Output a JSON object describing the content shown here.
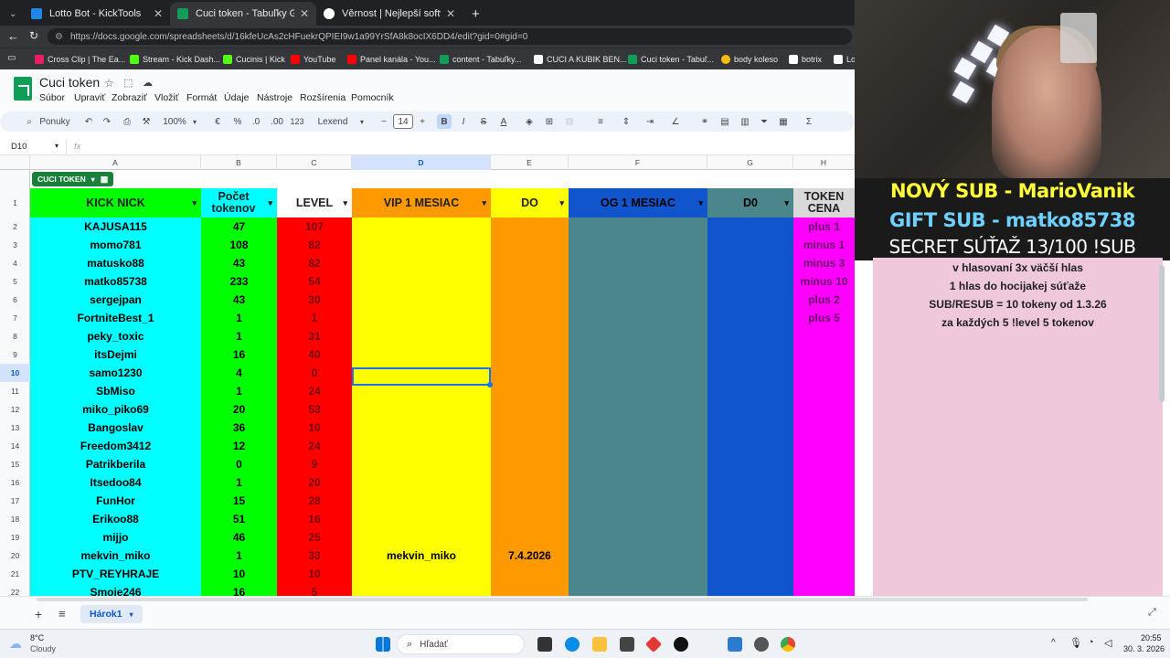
{
  "browser": {
    "tabs": [
      {
        "title": "Lotto Bot - KickTools",
        "icon_color": "#1e88e5"
      },
      {
        "title": "Cuci token - Tabuľky Google",
        "icon_color": "#0f9d58"
      },
      {
        "title": "Věrnost | Nejlepší software pro vyh",
        "icon_color": "#ffffff"
      }
    ],
    "url": "https://docs.google.com/spreadsheets/d/16kfeUcAs2cHFuekrQPIEI9w1a99YrSfA8k8ocIX6DD4/edit?gid=0#gid=0",
    "bookmarks": [
      {
        "label": "Cross Clip | The Ea...",
        "color": "#e91e63"
      },
      {
        "label": "Stream - Kick Dash...",
        "color": "#53fc18"
      },
      {
        "label": "Cucinis | Kick",
        "color": "#53fc18"
      },
      {
        "label": "YouTube",
        "color": "#ff0000"
      },
      {
        "label": "Panel kanála - You...",
        "color": "#ff0000"
      },
      {
        "label": "content - Tabuľky...",
        "color": "#0f9d58"
      },
      {
        "label": "CUCI A KUBIK BEN...",
        "color": "#ffffff"
      },
      {
        "label": "Cuci token - Tabuľ...",
        "color": "#0f9d58"
      },
      {
        "label": "body koleso",
        "color": "#fbbc04"
      },
      {
        "label": "botrix",
        "color": "#ffffff"
      },
      {
        "label": "Lo",
        "color": "#ffffff"
      }
    ]
  },
  "sheets": {
    "title": "Cuci token",
    "menu": [
      "Súbor",
      "Upraviť",
      "Zobraziť",
      "Vložiť",
      "Formát",
      "Údaje",
      "Nástroje",
      "Rozšírenia",
      "Pomocník"
    ],
    "toolbar": {
      "search": "Ponuky",
      "zoom": "100%",
      "currency": "€",
      "percent": "%",
      "dec_minus": ".0",
      "dec_plus": ".00",
      "format": "123",
      "font": "Lexend",
      "font_size": "14",
      "bold": "B",
      "italic": "I",
      "strike": "S",
      "text_color": "A"
    },
    "cell_ref": "D10",
    "fx": "fx",
    "columns": [
      "A",
      "B",
      "C",
      "D",
      "E",
      "F",
      "G",
      "H"
    ],
    "table_name": "CUCI TOKEN",
    "headers": [
      "KICK NICK",
      "Počet tokenov",
      "LEVEL",
      "VIP 1 MESIAC",
      "DO",
      "OG 1 MESIAC",
      "D0",
      "TOKEN CENA"
    ],
    "row_numbers": [
      "1",
      "2",
      "3",
      "4",
      "5",
      "6",
      "7",
      "8",
      "9",
      "10",
      "11",
      "12",
      "13",
      "14",
      "15",
      "16",
      "17",
      "18",
      "19",
      "20",
      "21",
      "22"
    ],
    "rows": [
      [
        "KAJUSA115",
        "47",
        "107",
        "",
        "",
        "plus 1"
      ],
      [
        "momo781",
        "108",
        "82",
        "",
        "",
        "minus 1"
      ],
      [
        "matusko88",
        "43",
        "82",
        "",
        "",
        "minus 3"
      ],
      [
        "matko85738",
        "233",
        "54",
        "",
        "",
        "minus 10"
      ],
      [
        "sergejpan",
        "43",
        "30",
        "",
        "",
        "plus 2"
      ],
      [
        "FortniteBest_1",
        "1",
        "1",
        "",
        "",
        "plus 5"
      ],
      [
        "peky_toxic",
        "1",
        "31",
        "",
        "",
        ""
      ],
      [
        "itsDejmi",
        "16",
        "40",
        "",
        "",
        ""
      ],
      [
        "samo1230",
        "4",
        "0",
        "",
        "",
        ""
      ],
      [
        "SbMiso",
        "1",
        "24",
        "",
        "",
        ""
      ],
      [
        "miko_piko69",
        "20",
        "53",
        "",
        "",
        ""
      ],
      [
        "Bangoslav",
        "36",
        "10",
        "",
        "",
        ""
      ],
      [
        "Freedom3412",
        "12",
        "24",
        "",
        "",
        ""
      ],
      [
        "Patrikberila",
        "0",
        "9",
        "",
        "",
        ""
      ],
      [
        "Itsedoo84",
        "1",
        "20",
        "",
        "",
        ""
      ],
      [
        "FunHor",
        "15",
        "28",
        "",
        "",
        ""
      ],
      [
        "Erikoo88",
        "51",
        "16",
        "",
        "",
        ""
      ],
      [
        "mijjo",
        "46",
        "25",
        "",
        "",
        ""
      ],
      [
        "mekvin_miko",
        "1",
        "33",
        "mekvin_miko",
        "7.4.2026",
        ""
      ],
      [
        "PTV_REYHRAJE",
        "10",
        "10",
        "",
        "",
        ""
      ],
      [
        "Smoje246",
        "16",
        "5",
        "",
        "",
        ""
      ]
    ],
    "notes": [
      "v hlasovaní 3x väčší hlas",
      "1 hlas do hocijakej súťaže",
      "SUB/RESUB = 10 tokeny od 1.3.26",
      "za každých 5 !level 5 tokenov"
    ],
    "sheet_tab": "Hárok1",
    "colors": {
      "col_a": "#00ffff",
      "col_b": "#00ff00",
      "col_c": "#ff0000",
      "col_d": "#ffff00",
      "col_e": "#ff9900",
      "col_f": "#4a868c",
      "col_g": "#1155cc",
      "col_h": "#ff00ff",
      "header_a": "#00ff00",
      "header_d": "#ff9900",
      "header_e": "#ffff00",
      "header_f": "#1155cc",
      "header_g": "#4a868c",
      "header_h": "#d9d9d9",
      "notes_bg": "#efc9db"
    }
  },
  "stream_overlay": {
    "new_sub": "NOVÝ SUB - MarioVanik",
    "gift_sub": "GIFT SUB - matko85738",
    "contest": "SECRET SÚŤAŽ  13/100 !SUB"
  },
  "taskbar": {
    "temperature": "8°C",
    "weather": "Cloudy",
    "search": "Hľadať",
    "time": "20:55",
    "date": "30. 3. 2026"
  }
}
